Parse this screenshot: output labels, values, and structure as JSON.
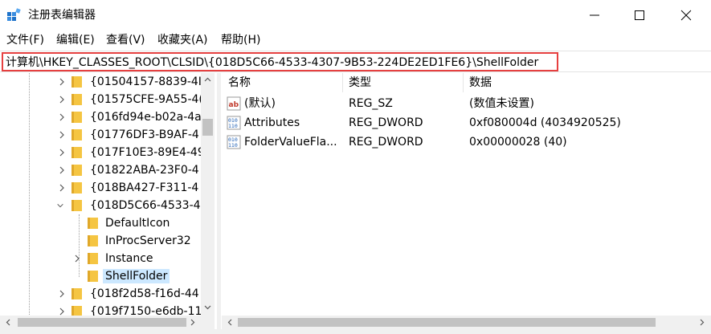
{
  "window": {
    "title": "注册表编辑器"
  },
  "menu": [
    "文件(F)",
    "编辑(E)",
    "查看(V)",
    "收藏夹(A)",
    "帮助(H)"
  ],
  "address": {
    "path": "计算机\\HKEY_CLASSES_ROOT\\CLSID\\{018D5C66-4533-4307-9B53-224DE2ED1FE6}\\ShellFolder"
  },
  "tree": {
    "items": [
      {
        "label": "{01504157-8839-4I",
        "expanded": false
      },
      {
        "label": "{01575CFE-9A55-4(",
        "expanded": false
      },
      {
        "label": "{016fd94e-b02a-4a",
        "expanded": false
      },
      {
        "label": "{01776DF3-B9AF-4",
        "expanded": false
      },
      {
        "label": "{017F10E3-89E4-49",
        "expanded": false
      },
      {
        "label": "{01822ABA-23F0-4",
        "expanded": false
      },
      {
        "label": "{018BA427-F311-4",
        "expanded": false
      },
      {
        "label": "{018D5C66-4533-4",
        "expanded": true
      },
      {
        "label": "DefaultIcon",
        "child": true
      },
      {
        "label": "InProcServer32",
        "child": true
      },
      {
        "label": "Instance",
        "child": true,
        "expandable": true
      },
      {
        "label": "ShellFolder",
        "child": true,
        "selected": true
      },
      {
        "label": "{018f2d58-f16d-44",
        "expanded": false
      },
      {
        "label": "{019f7150-e6db-11",
        "expanded": false
      }
    ]
  },
  "values": {
    "columns": [
      "名称",
      "类型",
      "数据"
    ],
    "rows": [
      {
        "icon": "string-value-icon",
        "name": "(默认)",
        "type": "REG_SZ",
        "data": "(数值未设置)"
      },
      {
        "icon": "binary-value-icon",
        "name": "Attributes",
        "type": "REG_DWORD",
        "data": "0xf080004d (4034920525)"
      },
      {
        "icon": "binary-value-icon",
        "name": "FolderValueFla...",
        "type": "REG_DWORD",
        "data": "0x00000028 (40)"
      }
    ]
  },
  "colors": {
    "highlight_border": "#e64040",
    "selection": "#cce8ff",
    "folder": "#f5c542"
  }
}
